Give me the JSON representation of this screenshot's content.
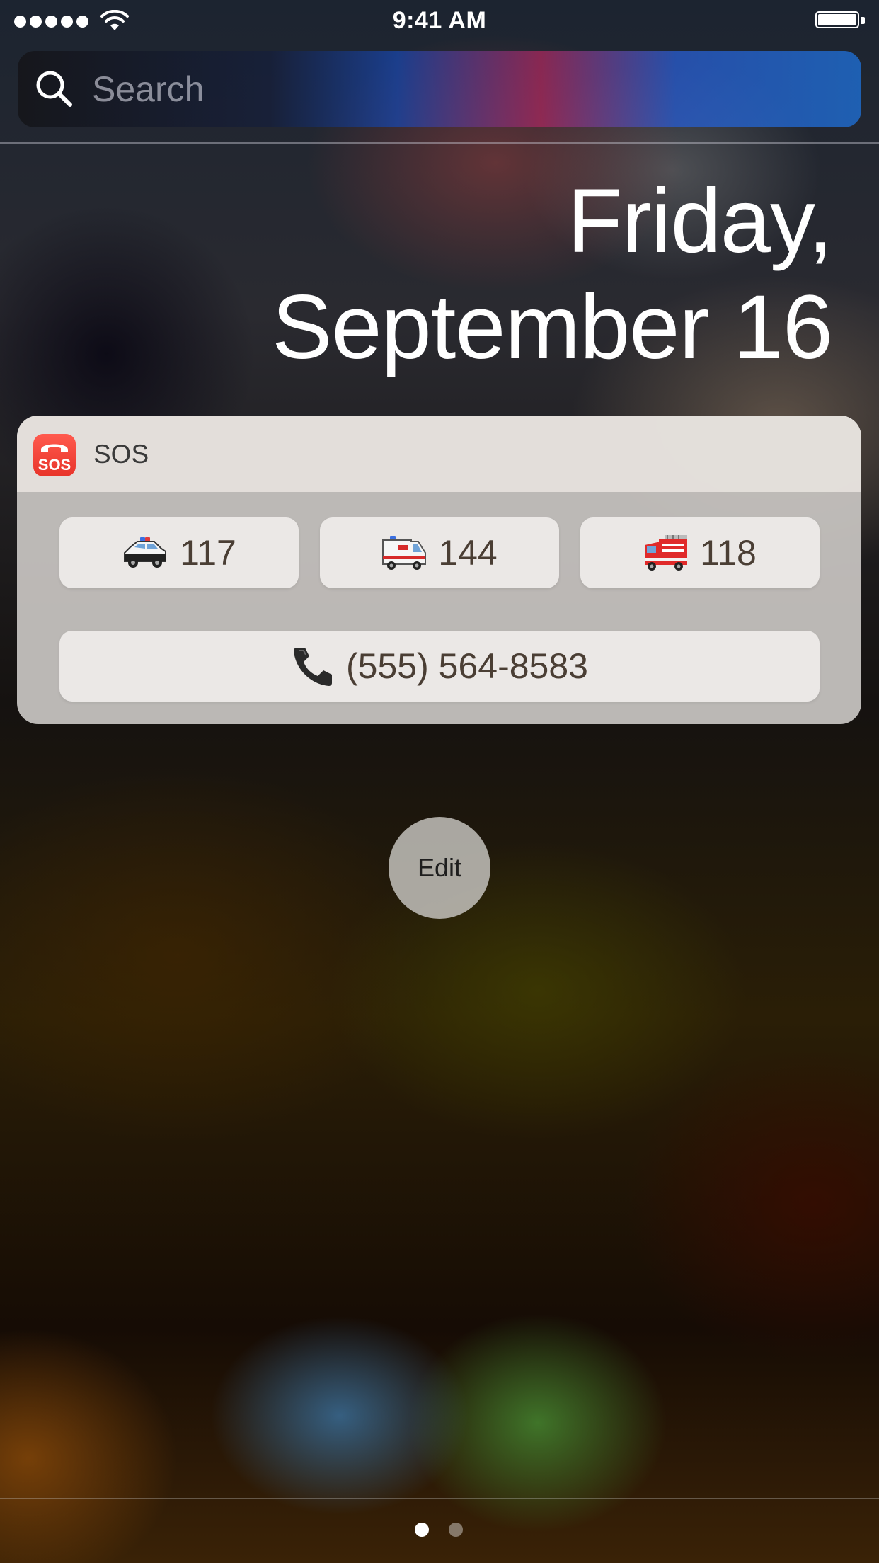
{
  "status_bar": {
    "time": "9:41 AM",
    "signal_icon": "signal-dots-icon",
    "wifi_icon": "wifi-icon",
    "battery_icon": "battery-icon"
  },
  "search": {
    "placeholder": "Search",
    "icon": "search-icon"
  },
  "date": {
    "weekday": "Friday,",
    "month_day": "September 16"
  },
  "widget": {
    "app_name": "SOS",
    "app_icon": "sos-phone-icon",
    "app_icon_text": "SOS",
    "buttons": [
      {
        "icon": "police-car-icon",
        "label": "117"
      },
      {
        "icon": "ambulance-icon",
        "label": "144"
      },
      {
        "icon": "fire-engine-icon",
        "label": "118"
      }
    ],
    "phone_button": {
      "icon": "telephone-receiver-icon",
      "label": "(555) 564-8583"
    }
  },
  "edit_label": "Edit",
  "page_dots": {
    "count": 2,
    "active_index": 0
  },
  "colors": {
    "app_icon_red": "#f0443a",
    "widget_bg": "#c8c5c2",
    "button_text": "#4a3e34"
  }
}
